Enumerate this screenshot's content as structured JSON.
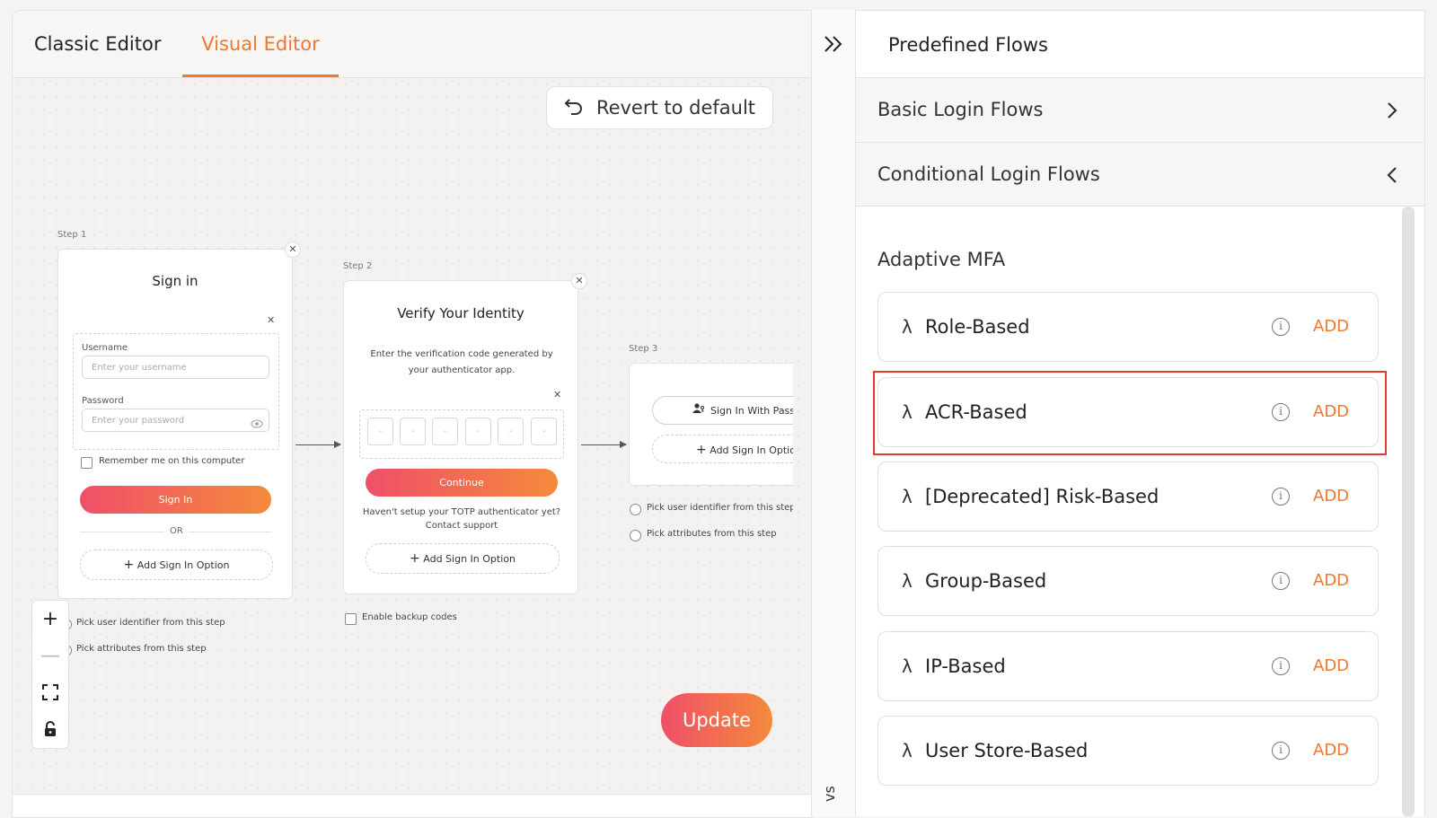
{
  "tabs": {
    "classic": "Classic Editor",
    "visual": "Visual Editor"
  },
  "toolbar": {
    "revert_label": "Revert to default",
    "update_label": "Update"
  },
  "steps": {
    "step1": {
      "label": "Step 1",
      "title": "Sign in",
      "username_label": "Username",
      "username_placeholder": "Enter your username",
      "password_label": "Password",
      "password_placeholder": "Enter your password",
      "remember": "Remember me on this computer",
      "signin_button": "Sign In",
      "or": "OR",
      "add_option": "Add Sign In Option",
      "pick_identifier": "Pick user identifier from this step",
      "pick_attributes": "Pick attributes from this step"
    },
    "step2": {
      "label": "Step 2",
      "title": "Verify Your Identity",
      "description": "Enter the verification code generated by your authenticator app.",
      "otp_placeholder": "-",
      "continue_button": "Continue",
      "help_line1": "Haven't setup your TOTP authenticator yet?",
      "help_line2": "Contact support",
      "add_option": "Add Sign In Option",
      "enable_backup": "Enable backup codes"
    },
    "step3": {
      "label": "Step 3",
      "passkey_button": "Sign In With Passke",
      "add_option": "Add Sign In Optior",
      "pick_identifier": "Pick user identifier from this step",
      "pick_attributes": "Pick attributes from this step"
    }
  },
  "zoom_controls": {
    "zoom_in": "+",
    "zoom_out": "—",
    "fit": "⛶",
    "lock": "🔒"
  },
  "side_collapse": {
    "icon": "»",
    "vertical_label": "vs"
  },
  "predefined": {
    "title": "Predefined Flows",
    "basic": "Basic Login Flows",
    "conditional": "Conditional Login Flows",
    "adaptive_title": "Adaptive MFA",
    "flows": [
      {
        "name": "Role-Based",
        "add": "ADD"
      },
      {
        "name": "ACR-Based",
        "add": "ADD"
      },
      {
        "name": "[Deprecated] Risk-Based",
        "add": "ADD"
      },
      {
        "name": "Group-Based",
        "add": "ADD"
      },
      {
        "name": "IP-Based",
        "add": "ADD"
      },
      {
        "name": "User Store-Based",
        "add": "ADD"
      }
    ]
  },
  "colors": {
    "accent": "#f0772e",
    "highlight": "#e53a2f",
    "gradient_start": "#ef4f68",
    "gradient_end": "#f58a3c"
  }
}
